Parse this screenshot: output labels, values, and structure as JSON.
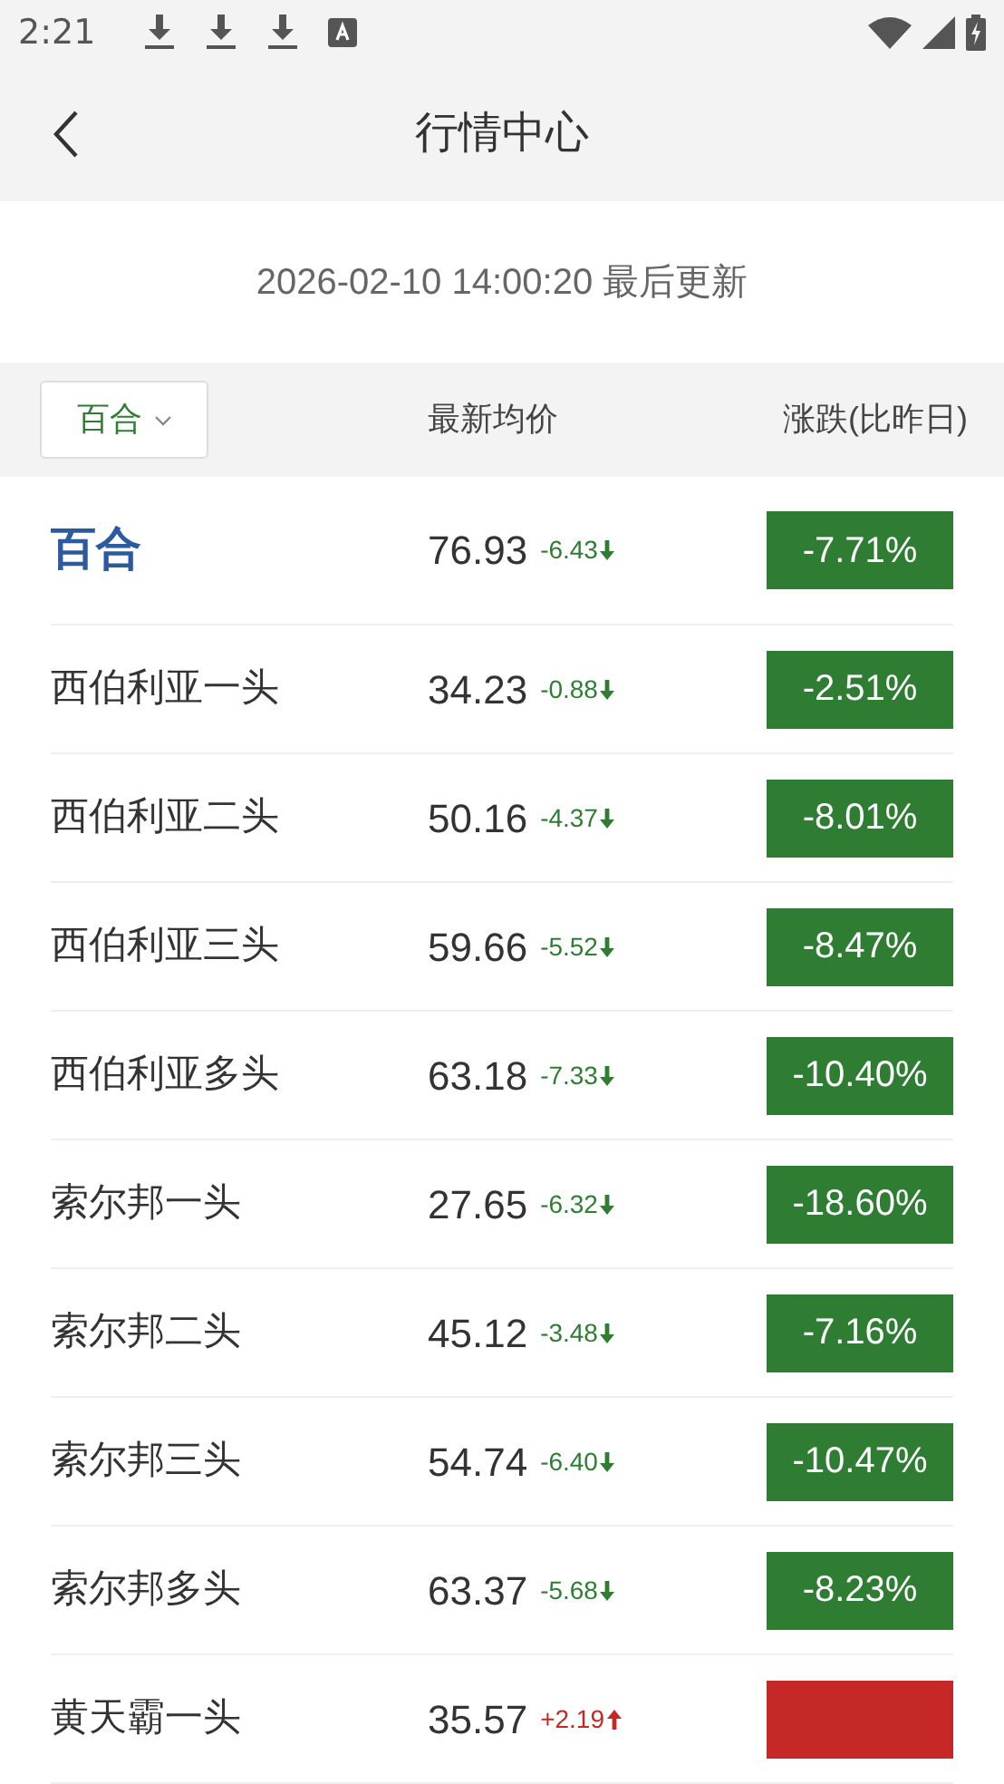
{
  "status_bar": {
    "time": "2:21"
  },
  "nav": {
    "title": "行情中心"
  },
  "update_line": "2026-02-10 14:00:20 最后更新",
  "table": {
    "filter": {
      "label": "百合"
    },
    "columns": [
      "最新均价",
      "涨跌(比昨日)"
    ],
    "rows": [
      {
        "name": "百合",
        "highlighted": true,
        "price": "76.93",
        "change": "-6.43",
        "kind": "fall",
        "color": "#2e7d32",
        "percent": "-7.71%"
      },
      {
        "name": "西伯利亚一头",
        "highlighted": false,
        "price": "34.23",
        "change": "-0.88",
        "kind": "fall",
        "color": "#2e7d32",
        "percent": "-2.51%"
      },
      {
        "name": "西伯利亚二头",
        "highlighted": false,
        "price": "50.16",
        "change": "-4.37",
        "kind": "fall",
        "color": "#2e7d32",
        "percent": "-8.01%"
      },
      {
        "name": "西伯利亚三头",
        "highlighted": false,
        "price": "59.66",
        "change": "-5.52",
        "kind": "fall",
        "color": "#2e7d32",
        "percent": "-8.47%"
      },
      {
        "name": "西伯利亚多头",
        "highlighted": false,
        "price": "63.18",
        "change": "-7.33",
        "kind": "fall",
        "color": "#2e7d32",
        "percent": "-10.40%"
      },
      {
        "name": "索尔邦一头",
        "highlighted": false,
        "price": "27.65",
        "change": "-6.32",
        "kind": "fall",
        "color": "#2e7d32",
        "percent": "-18.60%"
      },
      {
        "name": "索尔邦二头",
        "highlighted": false,
        "price": "45.12",
        "change": "-3.48",
        "kind": "fall",
        "color": "#2e7d32",
        "percent": "-7.16%"
      },
      {
        "name": "索尔邦三头",
        "highlighted": false,
        "price": "54.74",
        "change": "-6.40",
        "kind": "fall",
        "color": "#2e7d32",
        "percent": "-10.47%"
      },
      {
        "name": "索尔邦多头",
        "highlighted": false,
        "price": "63.37",
        "change": "-5.68",
        "kind": "fall",
        "color": "#2e7d32",
        "percent": "-8.23%"
      },
      {
        "name": "黄天霸一头",
        "highlighted": false,
        "price": "35.57",
        "change": "+2.19",
        "kind": "rise",
        "color": "#c62828"
      }
    ]
  }
}
